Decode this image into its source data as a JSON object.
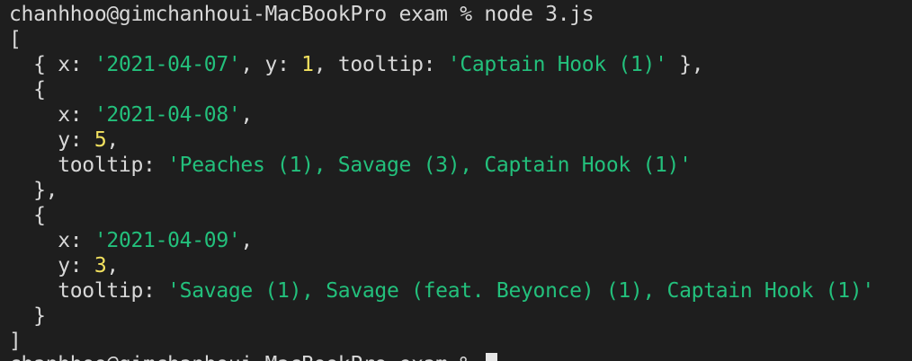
{
  "terminal": {
    "colors": {
      "background": "#1e1e1e",
      "text": "#d8d8d8",
      "string": "#23c07c",
      "number": "#f2e15f",
      "cursor": "#e6e6e6"
    },
    "prompt": {
      "host": "chanhhoo@gimchanhoui-MacBookPro",
      "dir": "exam",
      "symbol": "%",
      "command": "node 3.js"
    },
    "output": {
      "open_bracket": "[",
      "close_bracket": "]",
      "entries": [
        {
          "x": "'2021-04-07'",
          "y": "1",
          "tooltip": "'Captain Hook (1)'"
        },
        {
          "x": "'2021-04-08'",
          "y": "5",
          "tooltip": "'Peaches (1), Savage (3), Captain Hook (1)'"
        },
        {
          "x": "'2021-04-09'",
          "y": "3",
          "tooltip": "'Savage (1), Savage (feat. Beyonce) (1), Captain Hook (1)'"
        }
      ]
    },
    "next_prompt": {
      "host": "chanhhoo@gimchanhoui-MacBookPro",
      "dir": "exam",
      "symbol": "%"
    }
  }
}
